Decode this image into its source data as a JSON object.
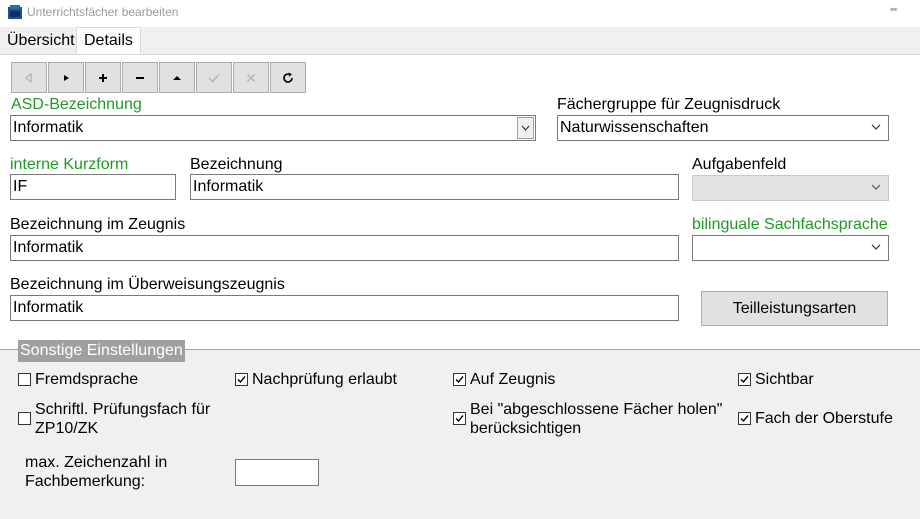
{
  "window": {
    "title": "Unterrichtsfächer bearbeiten"
  },
  "tabs": [
    {
      "label": "Übersicht",
      "active": false
    },
    {
      "label": "Details",
      "active": true
    }
  ],
  "toolbar": [
    {
      "name": "prev",
      "icon": "triangle-left-icon",
      "enabled": false
    },
    {
      "name": "next",
      "icon": "triangle-right-icon",
      "enabled": true
    },
    {
      "name": "add",
      "icon": "plus-icon",
      "enabled": true
    },
    {
      "name": "delete",
      "icon": "minus-icon",
      "enabled": true
    },
    {
      "name": "up",
      "icon": "triangle-up-icon",
      "enabled": true
    },
    {
      "name": "confirm",
      "icon": "check-icon",
      "enabled": false
    },
    {
      "name": "cancel",
      "icon": "x-icon",
      "enabled": false
    },
    {
      "name": "refresh",
      "icon": "refresh-icon",
      "enabled": true
    }
  ],
  "form": {
    "asd": {
      "label": "ASD-Bezeichnung",
      "value": "Informatik"
    },
    "faechergruppe": {
      "label": "Fächergruppe für Zeugnisdruck",
      "value": "Naturwissenschaften"
    },
    "kurzform": {
      "label": "interne Kurzform",
      "value": "IF"
    },
    "bezeichnung": {
      "label": "Bezeichnung",
      "value": "Informatik"
    },
    "aufgabenfeld": {
      "label": "Aufgabenfeld",
      "value": ""
    },
    "zeugnis": {
      "label": "Bezeichnung im Zeugnis",
      "value": "Informatik"
    },
    "bilingual": {
      "label": "bilinguale Sachfachsprache",
      "value": ""
    },
    "ueberweisung": {
      "label": "Bezeichnung im Überweisungszeugnis",
      "value": "Informatik"
    },
    "teilleistung_button": "Teilleistungsarten"
  },
  "settings": {
    "title": "Sonstige Einstellungen",
    "fremdsprache": {
      "label": "Fremdsprache",
      "checked": false
    },
    "nachpruefung": {
      "label": "Nachprüfung erlaubt",
      "checked": true
    },
    "auf_zeugnis": {
      "label": "Auf Zeugnis",
      "checked": true
    },
    "sichtbar": {
      "label": "Sichtbar",
      "checked": true
    },
    "schriftl_line1": "Schriftl. Prüfungsfach für",
    "schriftl_line2": "ZP10/ZK",
    "schriftl_checked": false,
    "abgeschl_line1": "Bei \"abgeschlossene Fächer holen\"",
    "abgeschl_line2": "berücksichtigen",
    "abgeschl_checked": true,
    "oberstufe": {
      "label": "Fach der Oberstufe",
      "checked": true
    },
    "maxzeichen_line1": "max. Zeichenzahl in",
    "maxzeichen_line2": "Fachbemerkung:",
    "maxzeichen_value": ""
  },
  "colors": {
    "accent_label": "#1f9a24",
    "group_title_bg": "#a0a0a0",
    "group_bg": "#f0f0f0"
  }
}
